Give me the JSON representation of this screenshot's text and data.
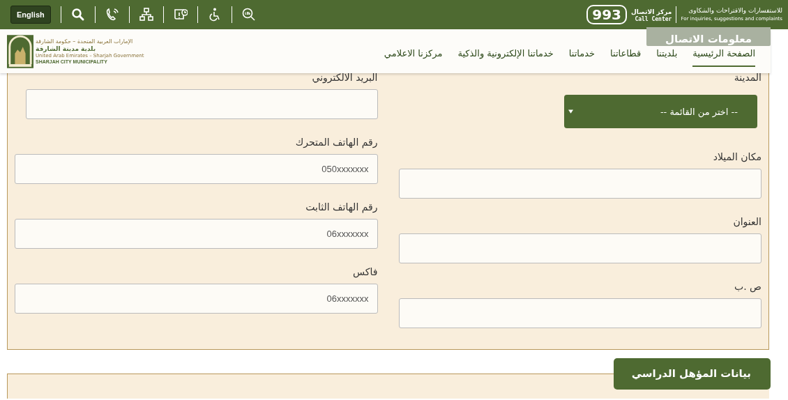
{
  "top_bar": {
    "language_button": "English",
    "call_center": {
      "note_ar": "للاستفسارات والاقتراحات والشكاوى",
      "note_en": "For inquiries, suggestions and complaints",
      "label_ar": "مركز الاتصال",
      "label_en": "Call Center",
      "number": "993"
    }
  },
  "logo": {
    "line_1": "الإمارات العربية المتحدة – حكومة الشارقة",
    "line_2": "بلدية مدينة الشارقة",
    "line_3": "United Arab Emirates – Sharjah Government",
    "line_4": "SHARJAH CITY MUNICIPALITY"
  },
  "nav": {
    "items": [
      {
        "label": "الصفحة الرئيسية",
        "selected": true
      },
      {
        "label": "بلديتنا",
        "selected": false
      },
      {
        "label": "قطاعاتنا",
        "selected": false
      },
      {
        "label": "خدماتنا",
        "selected": false
      },
      {
        "label": "خدماتنا الإلكترونية والذكية",
        "selected": false
      },
      {
        "label": "مركزنا الاعلامي",
        "selected": false
      }
    ],
    "dropdown_tab": "معلومات الاتصال"
  },
  "form": {
    "columns": [
      {
        "fields": [
          {
            "kind": "select",
            "label": "المدينة",
            "value": "-- اختر من القائمة --"
          },
          {
            "kind": "text",
            "label": "مكان الميلاد"
          },
          {
            "kind": "text",
            "label": "العنوان"
          },
          {
            "kind": "text",
            "label": "ص .ب"
          }
        ]
      },
      {
        "fields": [
          {
            "kind": "text",
            "label": "البريد الالكتروني"
          },
          {
            "kind": "text",
            "label": "رقم الهاتف المتحرك",
            "placeholder": "050xxxxxxx"
          },
          {
            "kind": "text",
            "label": "رقم الهاتف الثابت",
            "placeholder": "06xxxxxxx"
          },
          {
            "kind": "text",
            "label": "فاكس",
            "placeholder": "06xxxxxxx"
          }
        ]
      }
    ]
  },
  "next_section": {
    "title": "بيانات المؤهل الدراسي"
  }
}
